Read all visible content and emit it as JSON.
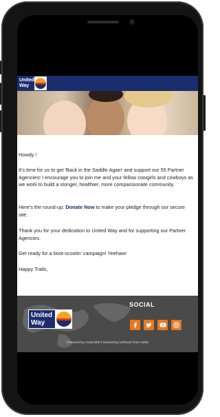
{
  "logo": {
    "line1": "United",
    "line2": "Way"
  },
  "email": {
    "greeting": "Howdy          !",
    "paragraphs": {
      "p1": "It's time for us to get 'Back in the Saddle Again' and support our 55 Partner Agencies! I encourage you to join me and your fellow cowgirls and cowboys as we work to build a stonger, healthier, more compassionate community.",
      "p2_before": "Here's the round-up: ",
      "p2_link": "Donate Now",
      "p2_after": " to make your pledge through our secure site.",
      "p3": "Thank you for your dedication to United Way and for supporting our Partner Agencies.",
      "p4": "Get ready for a boot-scootin' campaign! Yeehaw!",
      "closing": "Happy Trails,"
    }
  },
  "footer": {
    "social_title": "SOCIAL",
    "social_icons": [
      "facebook-icon",
      "twitter-icon",
      "youtube-icon",
      "instagram-icon"
    ],
    "powered_by": "Powered by Andar/360 Fundraising Software from Hellix"
  },
  "colors": {
    "brand_navy": "#1a2d6d",
    "social_orange": "#e9781f",
    "footer_gray": "#4a4a4a"
  }
}
